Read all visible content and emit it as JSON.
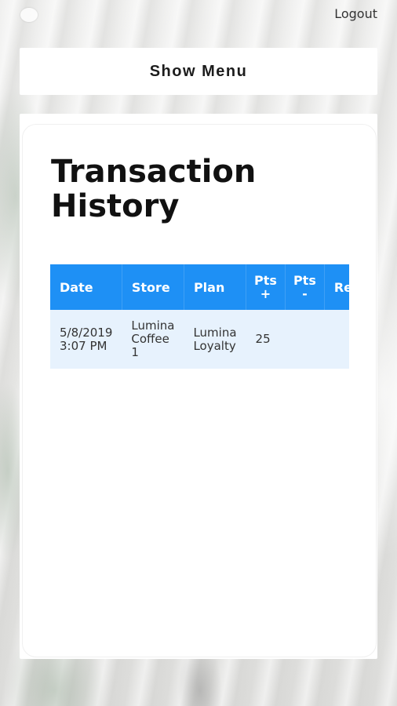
{
  "header": {
    "logout_label": "Logout"
  },
  "menu": {
    "show_menu_label": "Show Menu"
  },
  "page": {
    "title": "Transaction History"
  },
  "table": {
    "columns": [
      "Date",
      "Store",
      "Plan",
      "Pts +",
      "Pts -",
      "Re"
    ],
    "rows": [
      {
        "date_line1": "5/8/2019",
        "date_line2": "3:07 PM",
        "store": [
          "Lumina",
          "Coffee",
          "1"
        ],
        "plan": [
          "Lumina",
          "Loyalty"
        ],
        "pts_plus": "25",
        "pts_minus": "",
        "re": ""
      }
    ]
  },
  "colors": {
    "header_bg": "#1e90f5",
    "row_bg": "#e7f2fd"
  }
}
